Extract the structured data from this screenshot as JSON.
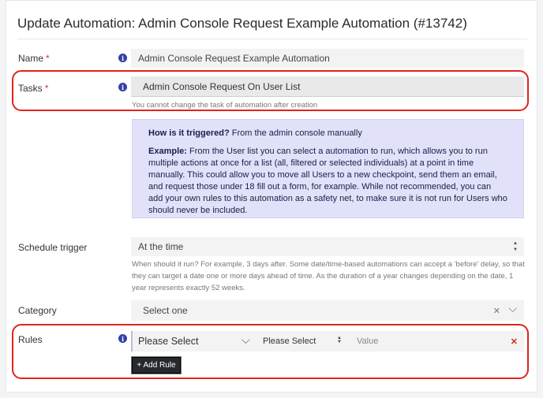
{
  "page": {
    "title": "Update Automation: Admin Console Request Example Automation (#13742)"
  },
  "fields": {
    "name": {
      "label": "Name",
      "required_mark": "*",
      "value": "Admin Console Request Example Automation"
    },
    "tasks": {
      "label": "Tasks",
      "required_mark": "*",
      "value": "Admin Console Request On User List",
      "helper": "You cannot change the task of automation after creation"
    },
    "schedule": {
      "label": "Schedule trigger",
      "value": "At the time",
      "helper": "When should it run? For example, 3 days after. Some date/time-based automations can accept a 'before' delay, so that they can target a date one or more days ahead of time. As the duration of a year changes depending on the date, 1 year represents exactly 52 weeks."
    },
    "category": {
      "label": "Category",
      "placeholder": "Select one",
      "clear_glyph": "✕",
      "chevron_glyph": "⌵"
    },
    "rules": {
      "label": "Rules",
      "select1": "Please Select",
      "select2": "Please Select",
      "value_placeholder": "Value",
      "remove_glyph": "✕",
      "add_button": "+ Add Rule"
    }
  },
  "notice": {
    "trigger_heading": "How is it triggered?",
    "trigger_text": " From the admin console manually",
    "example_heading": "Example:",
    "example_text": " From the User list you can select a automation to run, which allows you to run multiple actions at once for a list (all, filtered or selected individuals) at a point in time manually. This could allow you to move all Users to a new checkpoint, send them an email, and request those under 18 fill out a form, for example. While not recommended, you can add your own rules to this automation as a safety net, to make sure it is not run for Users who should never be included."
  },
  "icons": {
    "info": "i",
    "sort_arrows_up": "▲",
    "sort_arrows_down": "▼",
    "chevron": "⌵"
  },
  "colors": {
    "accent": "#3340a8",
    "highlight": "#e2231a",
    "notice_bg": "#e1e1f9"
  }
}
